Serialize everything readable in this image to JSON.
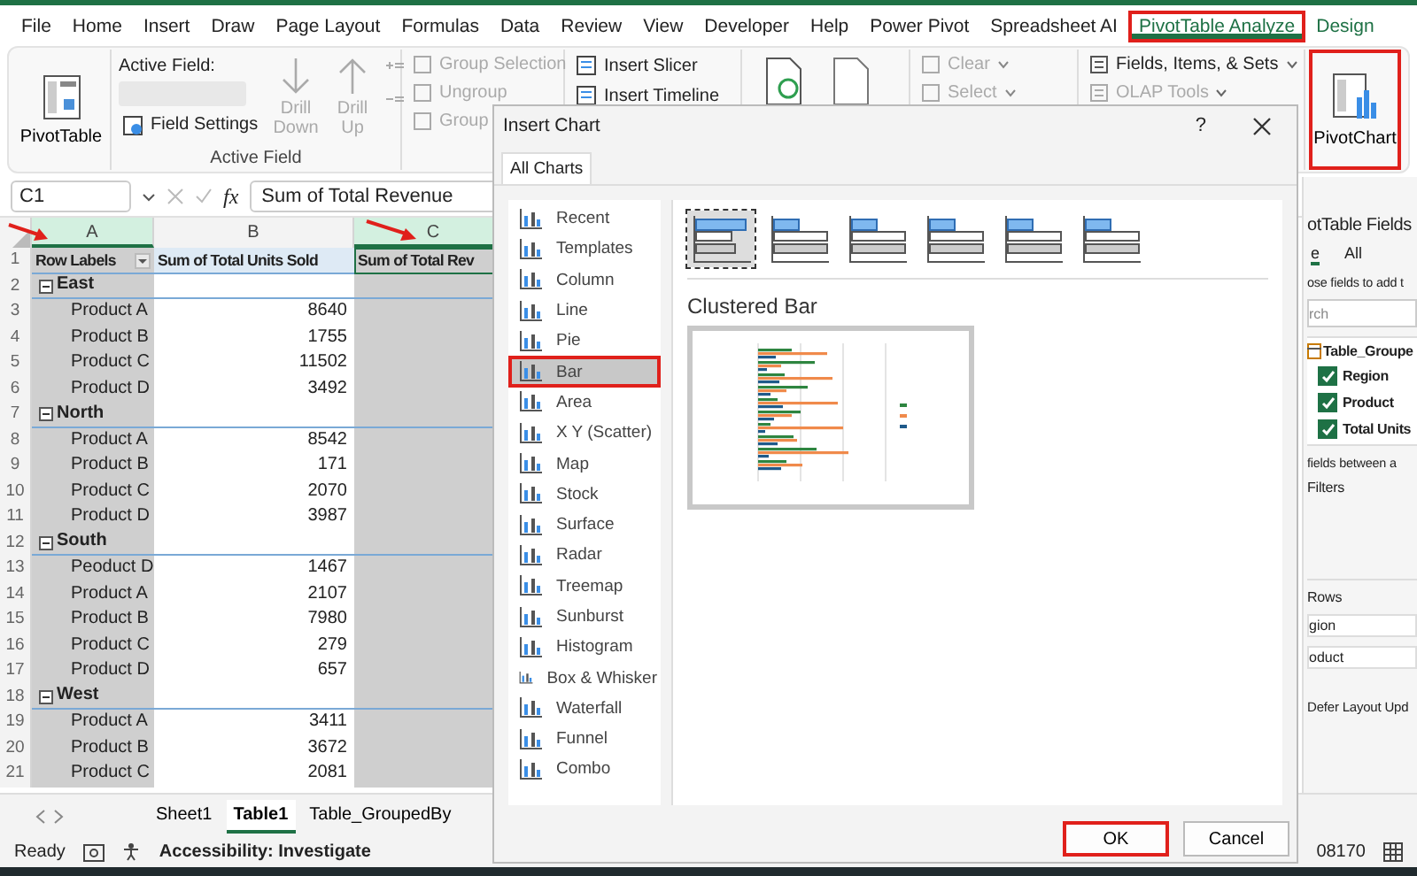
{
  "menu_tabs": [
    {
      "label": "File",
      "selected": false,
      "contextual": false,
      "highlighted": false
    },
    {
      "label": "Home",
      "selected": false,
      "contextual": false,
      "highlighted": false
    },
    {
      "label": "Insert",
      "selected": false,
      "contextual": false,
      "highlighted": false
    },
    {
      "label": "Draw",
      "selected": false,
      "contextual": false,
      "highlighted": false
    },
    {
      "label": "Page Layout",
      "selected": false,
      "contextual": false,
      "highlighted": false
    },
    {
      "label": "Formulas",
      "selected": false,
      "contextual": false,
      "highlighted": false
    },
    {
      "label": "Data",
      "selected": false,
      "contextual": false,
      "highlighted": false
    },
    {
      "label": "Review",
      "selected": false,
      "contextual": false,
      "highlighted": false
    },
    {
      "label": "View",
      "selected": false,
      "contextual": false,
      "highlighted": false
    },
    {
      "label": "Developer",
      "selected": false,
      "contextual": false,
      "highlighted": false
    },
    {
      "label": "Help",
      "selected": false,
      "contextual": false,
      "highlighted": false
    },
    {
      "label": "Power Pivot",
      "selected": false,
      "contextual": false,
      "highlighted": false
    },
    {
      "label": "Spreadsheet AI",
      "selected": false,
      "contextual": false,
      "highlighted": false
    },
    {
      "label": "PivotTable Analyze",
      "selected": true,
      "contextual": true,
      "highlighted": true
    },
    {
      "label": "Design",
      "selected": false,
      "contextual": true,
      "highlighted": false
    }
  ],
  "ribbon": {
    "pivottable": {
      "label": "PivotTable"
    },
    "active_field": {
      "label": "Active Field:",
      "field_settings": "Field Settings",
      "group_label": "Active Field",
      "drills": [
        {
          "label": "Drill Down",
          "disabled": true
        },
        {
          "label": "Drill Up",
          "disabled": true
        }
      ]
    },
    "group_items": [
      {
        "label": "Group Selection",
        "disabled": true
      },
      {
        "label": "Ungroup",
        "disabled": true
      },
      {
        "label": "Group",
        "disabled": true
      }
    ],
    "filter_items": [
      {
        "label": "Insert Slicer",
        "disabled": false
      },
      {
        "label": "Insert Timeline",
        "disabled": false
      }
    ],
    "action_items": [
      {
        "label": "Clear",
        "disabled": true
      },
      {
        "label": "Select",
        "disabled": true
      }
    ],
    "calc_items": [
      {
        "label": "Fields, Items, & Sets",
        "disabled": false
      },
      {
        "label": "OLAP Tools",
        "disabled": true
      }
    ],
    "pivotchart": {
      "label": "PivotChart",
      "highlighted": true
    }
  },
  "formula_bar": {
    "name_box": "C1",
    "fx": "fx",
    "formula": "Sum of Total Revenue"
  },
  "columns": [
    {
      "label": "A",
      "selected": true
    },
    {
      "label": "B",
      "selected": false
    },
    {
      "label": "C",
      "selected": true
    }
  ],
  "rows": [
    {
      "num": "1",
      "kind": "header",
      "a": "Row Labels",
      "b": "Sum of Total Units Sold",
      "c": "Sum of Total Rev"
    },
    {
      "num": "2",
      "kind": "group",
      "a": "East",
      "expanded": true
    },
    {
      "num": "3",
      "kind": "item",
      "a": "Product A",
      "b": "8640"
    },
    {
      "num": "4",
      "kind": "item",
      "a": "Product B",
      "b": "1755"
    },
    {
      "num": "5",
      "kind": "item",
      "a": "Product C",
      "b": "11502"
    },
    {
      "num": "6",
      "kind": "item",
      "a": "Product D",
      "b": "3492"
    },
    {
      "num": "7",
      "kind": "group",
      "a": "North",
      "expanded": true
    },
    {
      "num": "8",
      "kind": "item",
      "a": "Product A",
      "b": "8542"
    },
    {
      "num": "9",
      "kind": "item",
      "a": "Product B",
      "b": "171"
    },
    {
      "num": "10",
      "kind": "item",
      "a": "Product C",
      "b": "2070"
    },
    {
      "num": "11",
      "kind": "item",
      "a": "Product D",
      "b": "3987"
    },
    {
      "num": "12",
      "kind": "group",
      "a": "South",
      "expanded": true
    },
    {
      "num": "13",
      "kind": "item",
      "a": "Peoduct D",
      "b": "1467"
    },
    {
      "num": "14",
      "kind": "item",
      "a": "Product A",
      "b": "2107"
    },
    {
      "num": "15",
      "kind": "item",
      "a": "Product B",
      "b": "7980"
    },
    {
      "num": "16",
      "kind": "item",
      "a": "Product C",
      "b": "279"
    },
    {
      "num": "17",
      "kind": "item",
      "a": "Product D",
      "b": "657"
    },
    {
      "num": "18",
      "kind": "group",
      "a": "West",
      "expanded": true
    },
    {
      "num": "19",
      "kind": "item",
      "a": "Product A",
      "b": "3411"
    },
    {
      "num": "20",
      "kind": "item",
      "a": "Product B",
      "b": "3672"
    },
    {
      "num": "21",
      "kind": "item",
      "a": "Product C",
      "b": "2081"
    }
  ],
  "sheet_tabs": [
    {
      "label": "Sheet1",
      "selected": false
    },
    {
      "label": "Table1",
      "selected": true
    },
    {
      "label": "Table_GroupedBy",
      "selected": false
    }
  ],
  "status_bar": {
    "ready": "Ready",
    "accessibility": "Accessibility: Investigate",
    "value": "08170"
  },
  "field_pane": {
    "title": "otTable Fields",
    "tabs": [
      {
        "label": "e",
        "selected": true
      },
      {
        "label": "All",
        "selected": false
      }
    ],
    "hint": "ose fields to add t",
    "search_placeholder": "rch",
    "table": "Table_Groupe",
    "fields": [
      {
        "label": "Region",
        "checked": true
      },
      {
        "label": "Product",
        "checked": true
      },
      {
        "label": "Total Units",
        "checked": true
      }
    ],
    "drag_hint": "fields between a",
    "filters": "Filters",
    "rows_label": "Rows",
    "row_fields": [
      "gion",
      "oduct"
    ],
    "defer": "Defer Layout Upd"
  },
  "dialog": {
    "title": "Insert Chart",
    "help": "?",
    "tab": "All Charts",
    "chart_types": [
      {
        "label": "Recent",
        "selected": false,
        "highlighted": false
      },
      {
        "label": "Templates",
        "selected": false,
        "highlighted": false
      },
      {
        "label": "Column",
        "selected": false,
        "highlighted": false
      },
      {
        "label": "Line",
        "selected": false,
        "highlighted": false
      },
      {
        "label": "Pie",
        "selected": false,
        "highlighted": false
      },
      {
        "label": "Bar",
        "selected": true,
        "highlighted": true
      },
      {
        "label": "Area",
        "selected": false,
        "highlighted": false
      },
      {
        "label": "X Y (Scatter)",
        "selected": false,
        "highlighted": false
      },
      {
        "label": "Map",
        "selected": false,
        "highlighted": false
      },
      {
        "label": "Stock",
        "selected": false,
        "highlighted": false
      },
      {
        "label": "Surface",
        "selected": false,
        "highlighted": false
      },
      {
        "label": "Radar",
        "selected": false,
        "highlighted": false
      },
      {
        "label": "Treemap",
        "selected": false,
        "highlighted": false
      },
      {
        "label": "Sunburst",
        "selected": false,
        "highlighted": false
      },
      {
        "label": "Histogram",
        "selected": false,
        "highlighted": false
      },
      {
        "label": "Box & Whisker",
        "selected": false,
        "highlighted": false
      },
      {
        "label": "Waterfall",
        "selected": false,
        "highlighted": false
      },
      {
        "label": "Funnel",
        "selected": false,
        "highlighted": false
      },
      {
        "label": "Combo",
        "selected": false,
        "highlighted": false
      }
    ],
    "subtypes": [
      {
        "selected": true
      },
      {
        "selected": false
      },
      {
        "selected": false
      },
      {
        "selected": false
      },
      {
        "selected": false
      },
      {
        "selected": false
      }
    ],
    "subtype_title": "Clustered Bar",
    "buttons": [
      {
        "label": "OK",
        "highlighted": true
      },
      {
        "label": "Cancel",
        "highlighted": false
      }
    ]
  }
}
